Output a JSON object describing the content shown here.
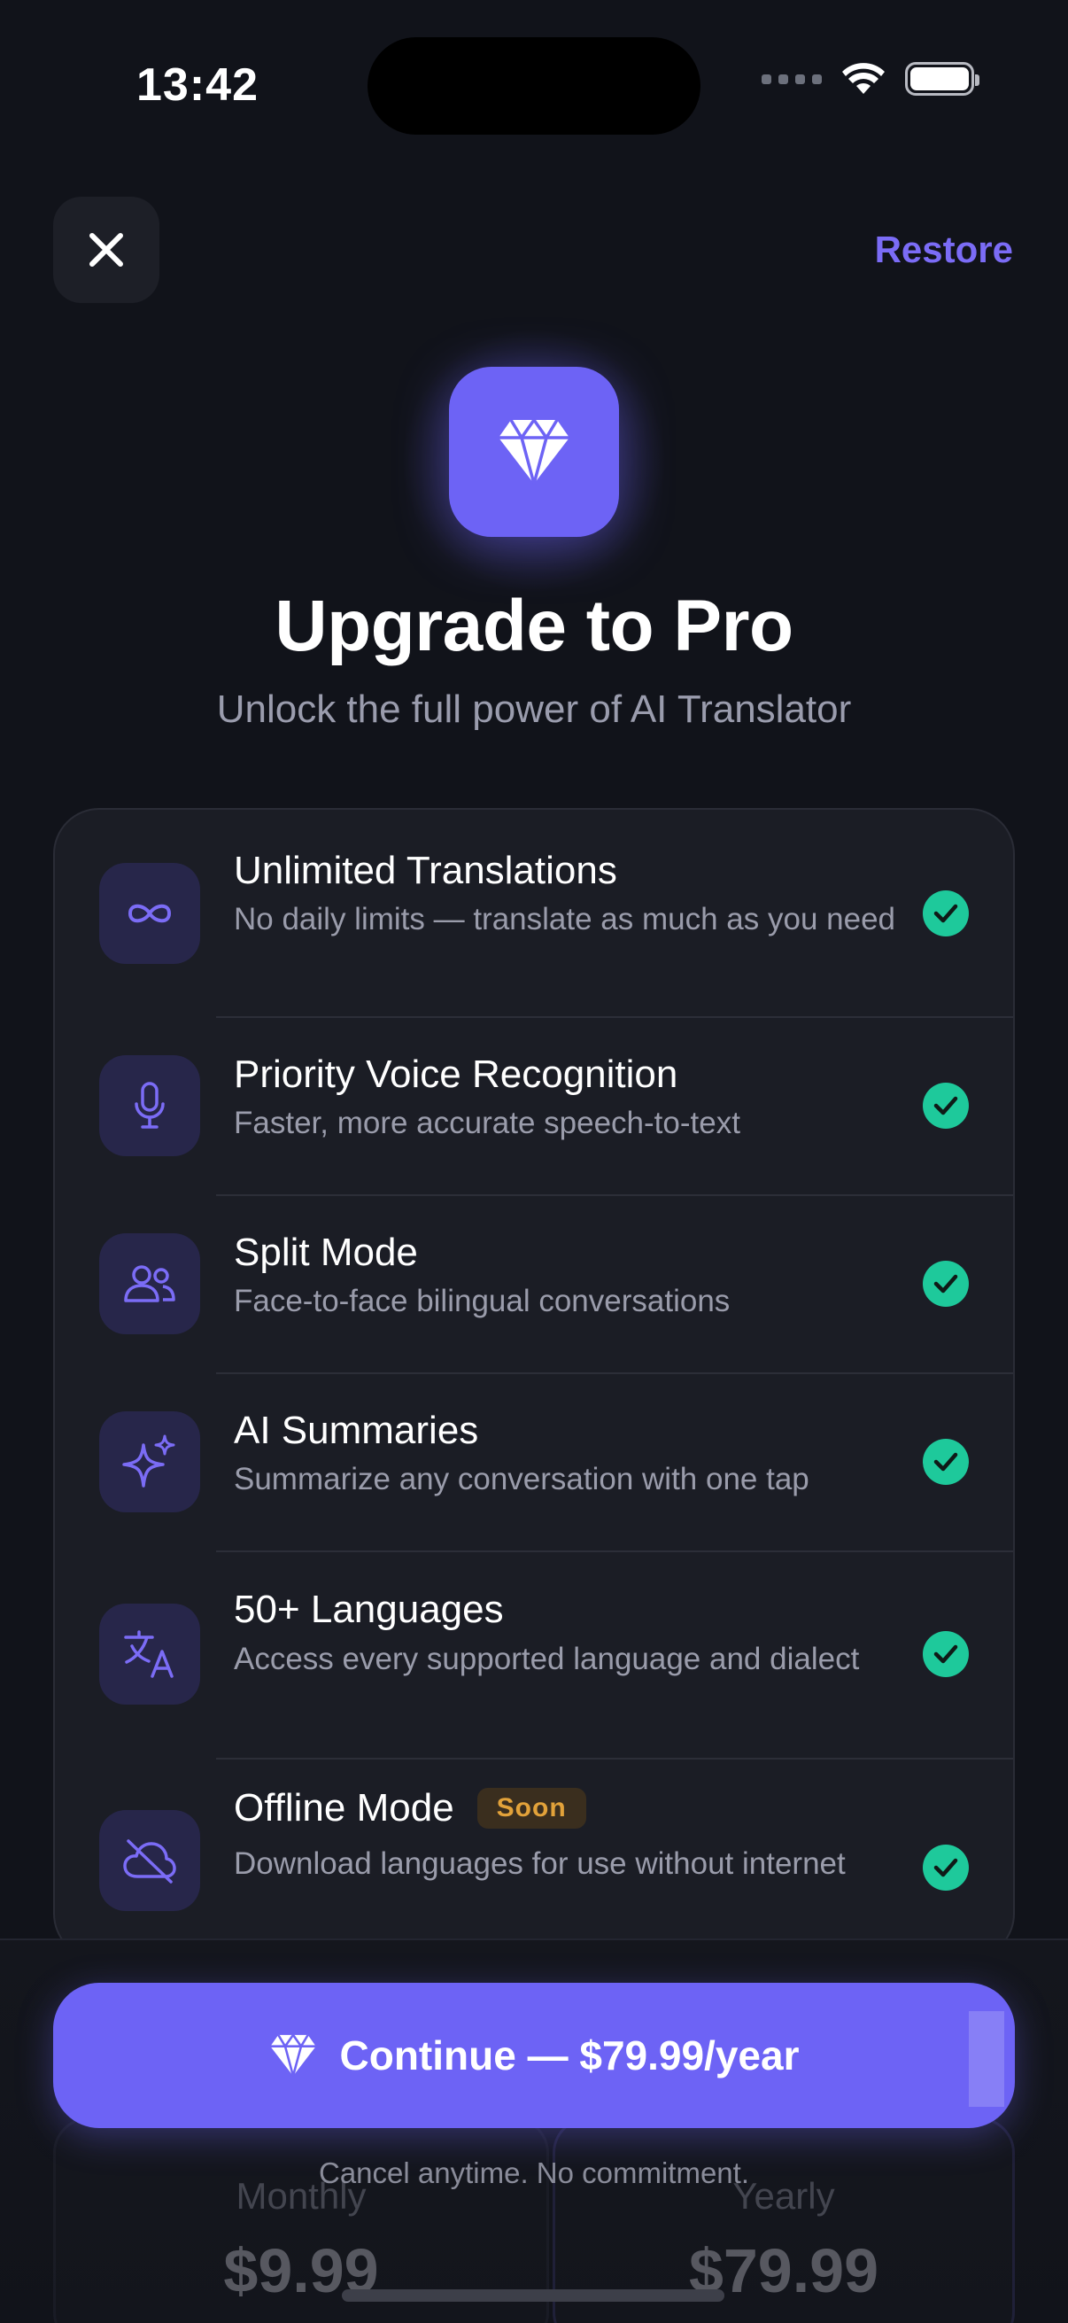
{
  "status_bar": {
    "time": "13:42"
  },
  "header": {
    "restore_label": "Restore"
  },
  "hero": {
    "title": "Upgrade to Pro",
    "subtitle": "Unlock the full power of AI Translator"
  },
  "features": [
    {
      "title": "Unlimited Translations",
      "description": "No daily limits — translate as much as you need",
      "icon": "infinity-icon"
    },
    {
      "title": "Priority Voice Recognition",
      "description": "Faster, more accurate speech-to-text",
      "icon": "microphone-icon"
    },
    {
      "title": "Split Mode",
      "description": "Face-to-face bilingual conversations",
      "icon": "people-icon"
    },
    {
      "title": "AI Summaries",
      "description": "Summarize any conversation with one tap",
      "icon": "sparkles-icon"
    },
    {
      "title": "50+ Languages",
      "description": "Access every supported language and dialect",
      "icon": "translate-icon"
    },
    {
      "title": "Offline Mode",
      "badge": "Soon",
      "description": "Download languages for use without internet",
      "icon": "cloud-off-icon"
    }
  ],
  "plans": [
    {
      "name": "Monthly",
      "price": "$9.99"
    },
    {
      "name": "Yearly",
      "price": "$79.99"
    }
  ],
  "cta": {
    "label": "Continue — $79.99/year"
  },
  "footer": {
    "note": "Cancel anytime. No commitment."
  },
  "colors": {
    "accent": "#6d63f5",
    "check": "#1ec99b",
    "badge": "#e2a23a",
    "background": "#11131a"
  }
}
